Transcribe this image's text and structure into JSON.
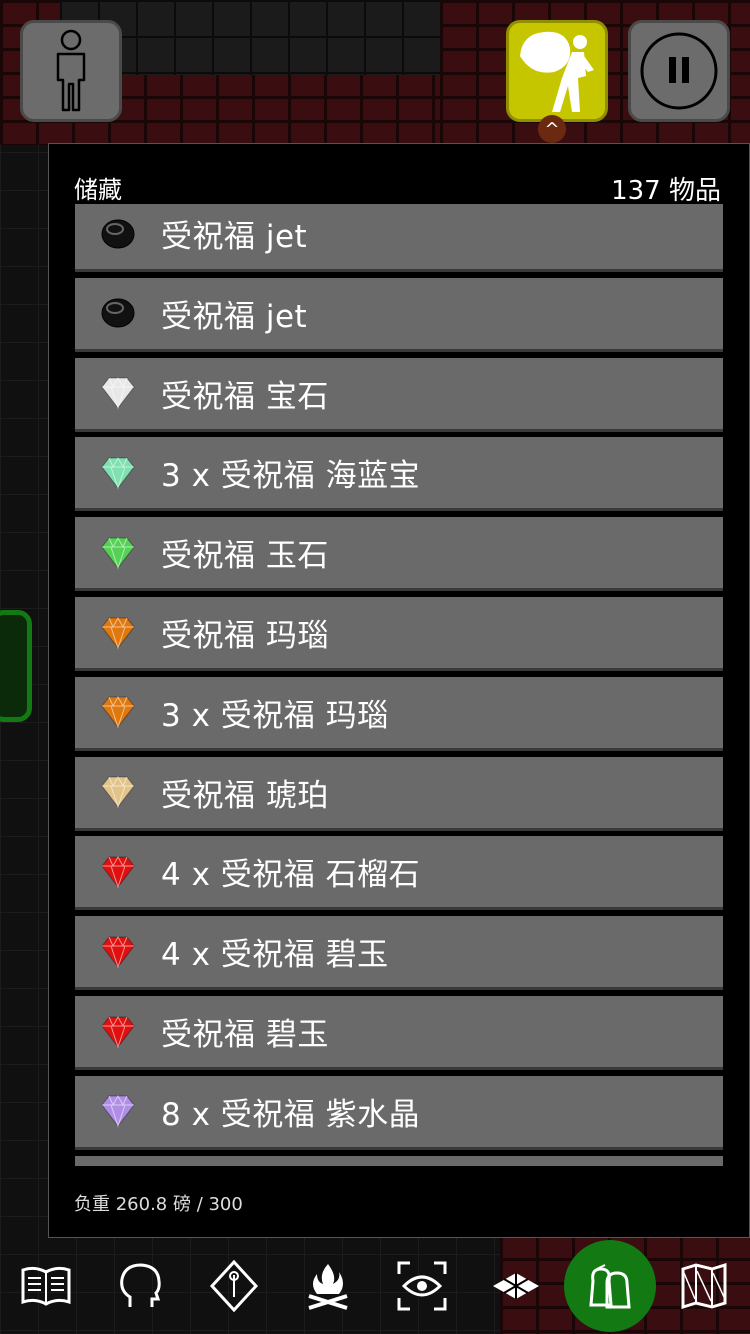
{
  "header": {
    "title": "储藏",
    "count": "137 物品"
  },
  "items": [
    {
      "label": "受祝福 jet",
      "gem": "jet",
      "color": "#111111"
    },
    {
      "label": "受祝福 jet",
      "gem": "jet",
      "color": "#111111"
    },
    {
      "label": "受祝福 宝石",
      "gem": "diamond",
      "color": "#e8e8e8"
    },
    {
      "label": "3 x 受祝福 海蓝宝",
      "gem": "diamond",
      "color": "#7fe0b0"
    },
    {
      "label": "受祝福 玉石",
      "gem": "diamond",
      "color": "#55d255"
    },
    {
      "label": "受祝福 玛瑙",
      "gem": "diamond",
      "color": "#e0780e"
    },
    {
      "label": "3 x 受祝福 玛瑙",
      "gem": "diamond",
      "color": "#e0780e"
    },
    {
      "label": "受祝福 琥珀",
      "gem": "diamond",
      "color": "#e2c48a"
    },
    {
      "label": "4 x 受祝福 石榴石",
      "gem": "diamond",
      "color": "#e01010"
    },
    {
      "label": "4 x 受祝福 碧玉",
      "gem": "diamond",
      "color": "#e01010"
    },
    {
      "label": "受祝福 碧玉",
      "gem": "diamond",
      "color": "#e01010"
    },
    {
      "label": "8 x 受祝福 紫水晶",
      "gem": "diamond",
      "color": "#b08ee8"
    }
  ],
  "footer": {
    "weight": "负重 260.8 磅 / 300"
  },
  "toolbar": [
    {
      "icon": "spellbook-icon"
    },
    {
      "icon": "head-profile-icon"
    },
    {
      "icon": "skill-diamond-icon"
    },
    {
      "icon": "campfire-icon"
    },
    {
      "icon": "look-eye-icon"
    },
    {
      "icon": "tiles-icon"
    },
    {
      "icon": "inventory-bags-icon",
      "active": true
    },
    {
      "icon": "map-icon"
    }
  ],
  "colors": {
    "bag_button": "#c6c600",
    "active_tool": "#137a13",
    "row_bg": "#6a6a6a"
  }
}
